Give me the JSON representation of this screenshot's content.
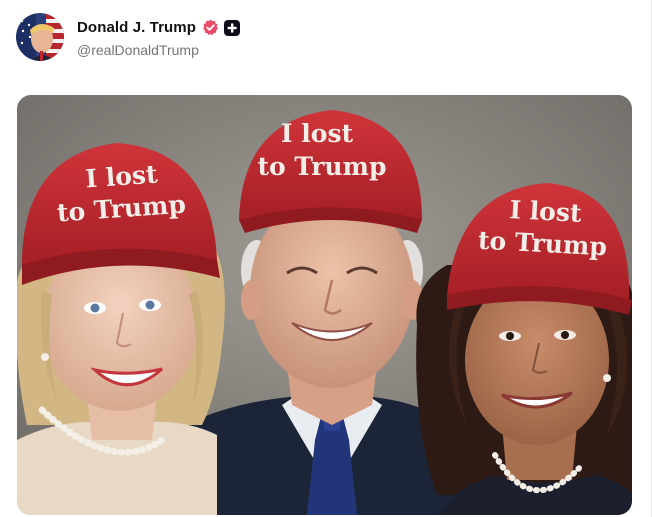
{
  "post": {
    "author": {
      "display_name": "Donald J. Trump",
      "handle": "@realDonaldTrump",
      "verified": true,
      "badge_icon": "plus-badge-icon",
      "avatar_icon": "profile-avatar"
    },
    "media": {
      "type": "image",
      "cap_text_line1": "I lost",
      "cap_text_line2": "to Trump",
      "colors": {
        "cap_red": "#c0262c",
        "suit_navy": "#1c2538",
        "tie_blue": "#22357a",
        "background": "#8a8680"
      }
    }
  }
}
